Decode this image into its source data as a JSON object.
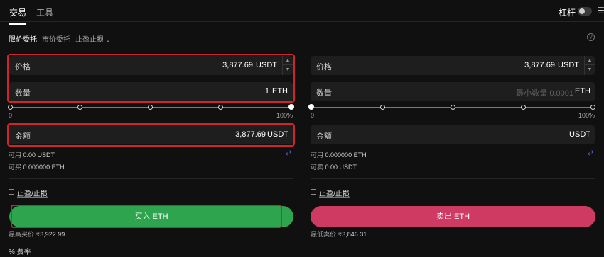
{
  "header": {
    "tabs": [
      "交易",
      "工具"
    ],
    "leverage_label": "杠杆",
    "menu_icon": "menu-icon"
  },
  "order_types": {
    "limit": "限价委托",
    "market": "市价委托",
    "stop": "止盈止损"
  },
  "buy": {
    "price_label": "价格",
    "price_value": "3,877.69",
    "price_unit": "USDT",
    "qty_label": "数量",
    "qty_value": "1",
    "qty_unit": "ETH",
    "slider_min": "0",
    "slider_max": "100%",
    "amount_label": "金额",
    "amount_value": "3,877.69",
    "amount_unit": "USDT",
    "available_label": "可用",
    "available_value": "0.00 USDT",
    "can_buy_label": "可买",
    "can_buy_value": "0.000000 ETH",
    "tpsl_label": "止盈/止损",
    "button_label": "买入 ETH",
    "max_price_label": "最高买价",
    "max_price_value": "₹3,922.99"
  },
  "sell": {
    "price_label": "价格",
    "price_value": "3,877.69",
    "price_unit": "USDT",
    "qty_label": "数量",
    "qty_placeholder": "最小数量 0.0001",
    "qty_unit": "ETH",
    "slider_min": "0",
    "slider_max": "100%",
    "amount_label": "金额",
    "amount_unit": "USDT",
    "available_label": "可用",
    "available_value": "0.000000 ETH",
    "can_sell_label": "可卖",
    "can_sell_value": "0.00 USDT",
    "tpsl_label": "止盈/止损",
    "button_label": "卖出 ETH",
    "min_price_label": "最低卖价",
    "min_price_value": "₹3,846.31"
  },
  "fee_label": "费率",
  "colors": {
    "buy": "#2ea44f",
    "sell": "#cf3a63",
    "highlight": "#d0242b",
    "swap_icon": "#5865f2"
  }
}
